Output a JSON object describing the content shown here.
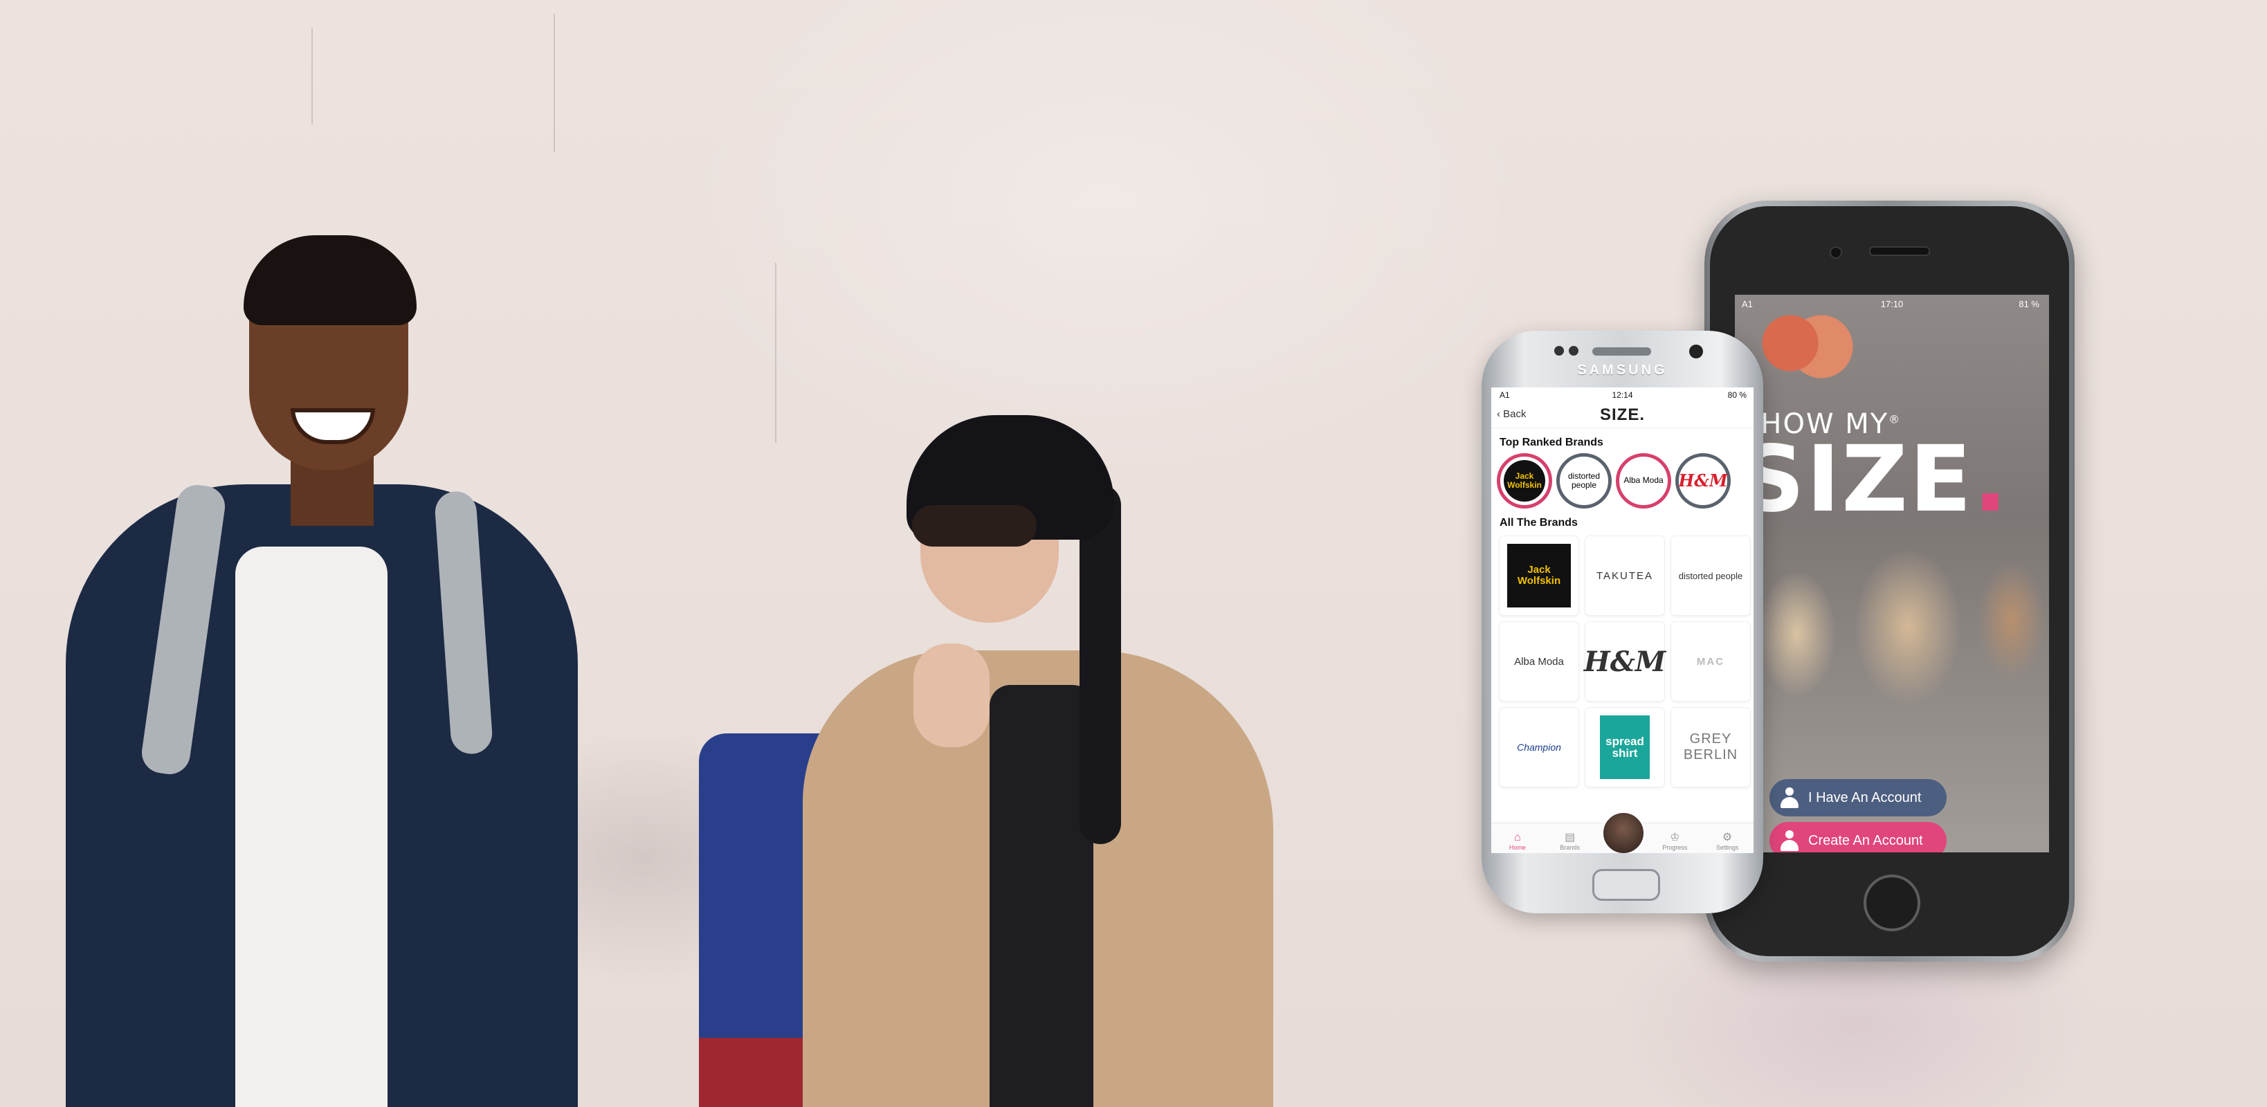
{
  "samsung": {
    "brand_text": "SAMSUNG",
    "status": {
      "carrier": "A1",
      "time": "12:14",
      "battery": "80 %"
    },
    "header": {
      "back_label": "Back",
      "logo": "SIZE."
    },
    "top_ranked_title": "Top Ranked Brands",
    "top_ranked": [
      {
        "label": "Jack Wolfskin",
        "ring": "pink"
      },
      {
        "label": "distorted people",
        "ring": "gray"
      },
      {
        "label": "Alba Moda",
        "ring": "pink"
      },
      {
        "label": "H&M",
        "ring": "gray"
      }
    ],
    "all_brands_title": "All The Brands",
    "brands": [
      "Jack Wolfskin",
      "TAKUTEA",
      "distorted people",
      "Alba Moda",
      "H&M",
      "MAC",
      "Champion",
      "spread shirt",
      "GREY BERLIN"
    ],
    "tabs": [
      {
        "label": "Home",
        "icon": "home-icon",
        "active": true
      },
      {
        "label": "Brands",
        "icon": "brands-icon",
        "active": false
      },
      {
        "label": "",
        "icon": "avatar",
        "active": false
      },
      {
        "label": "Progress",
        "icon": "trophy-icon",
        "active": false
      },
      {
        "label": "Settings",
        "icon": "gear-icon",
        "active": false
      }
    ]
  },
  "iphone": {
    "status": {
      "carrier": "A1",
      "time": "17:10",
      "battery": "81 %"
    },
    "logo_top": "SHOW MY",
    "logo_reg": "®",
    "logo_big": "SIZE",
    "logo_dot": ".",
    "login_button": "I Have An Account",
    "create_button": "Create An Account"
  },
  "colors": {
    "accent_pink": "#e0457b",
    "login_blue": "#4d5f80",
    "wall": "#e9dfdb"
  }
}
